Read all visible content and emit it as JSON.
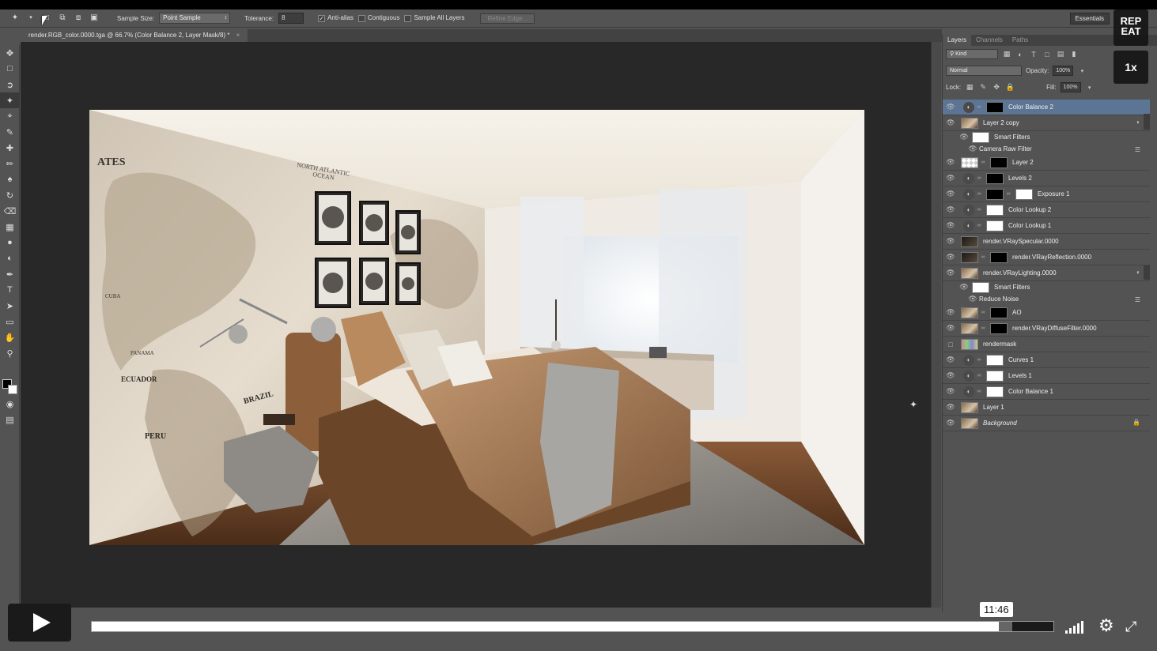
{
  "options_bar": {
    "sample_size_label": "Sample Size:",
    "sample_size_value": "Point Sample",
    "tolerance_label": "Tolerance:",
    "tolerance_value": "8",
    "anti_alias_label": "Anti-alias",
    "contiguous_label": "Contiguous",
    "sample_all_label": "Sample All Layers",
    "refine_edge_label": "Refine Edge...",
    "workspace_label": "Essentials"
  },
  "document": {
    "tab_title": "render.RGB_color.0000.tga @ 66.7% (Color Balance 2, Layer Mask/8) *",
    "close_glyph": "×"
  },
  "layers_panel": {
    "tabs": [
      "Layers",
      "Channels",
      "Paths"
    ],
    "filter_kind": "Kind",
    "blend_mode": "Normal",
    "opacity_label": "Opacity:",
    "opacity_value": "100%",
    "lock_label": "Lock:",
    "fill_label": "Fill:",
    "fill_value": "100%",
    "layers": [
      {
        "name": "Color Balance 2"
      },
      {
        "name": "Layer 2 copy"
      },
      {
        "name": "Smart Filters"
      },
      {
        "name": "Camera Raw Filter"
      },
      {
        "name": "Layer 2"
      },
      {
        "name": "Levels 2"
      },
      {
        "name": "Exposure 1"
      },
      {
        "name": "Color Lookup 2"
      },
      {
        "name": "Color Lookup 1"
      },
      {
        "name": "render.VRaySpecular.0000"
      },
      {
        "name": "render.VRayReflection.0000"
      },
      {
        "name": "render.VRayLighting.0000"
      },
      {
        "name": "Smart Filters"
      },
      {
        "name": "Reduce Noise"
      },
      {
        "name": "AO"
      },
      {
        "name": "render.VRayDiffuseFilter.0000"
      },
      {
        "name": "rendermask"
      },
      {
        "name": "Curves 1"
      },
      {
        "name": "Levels 1"
      },
      {
        "name": "Color Balance 1"
      },
      {
        "name": "Layer 1"
      },
      {
        "name": "Background"
      }
    ]
  },
  "player": {
    "time_tooltip": "11:46",
    "repeat_label_1": "REP",
    "repeat_label_2": "EAT",
    "speed_label": "1x",
    "progress_played": 0.943,
    "progress_buffered": 0.957
  },
  "colors": {
    "ui_gray": "#535353",
    "selected_layer": "#5d7595",
    "canvas_bg": "#282828"
  }
}
